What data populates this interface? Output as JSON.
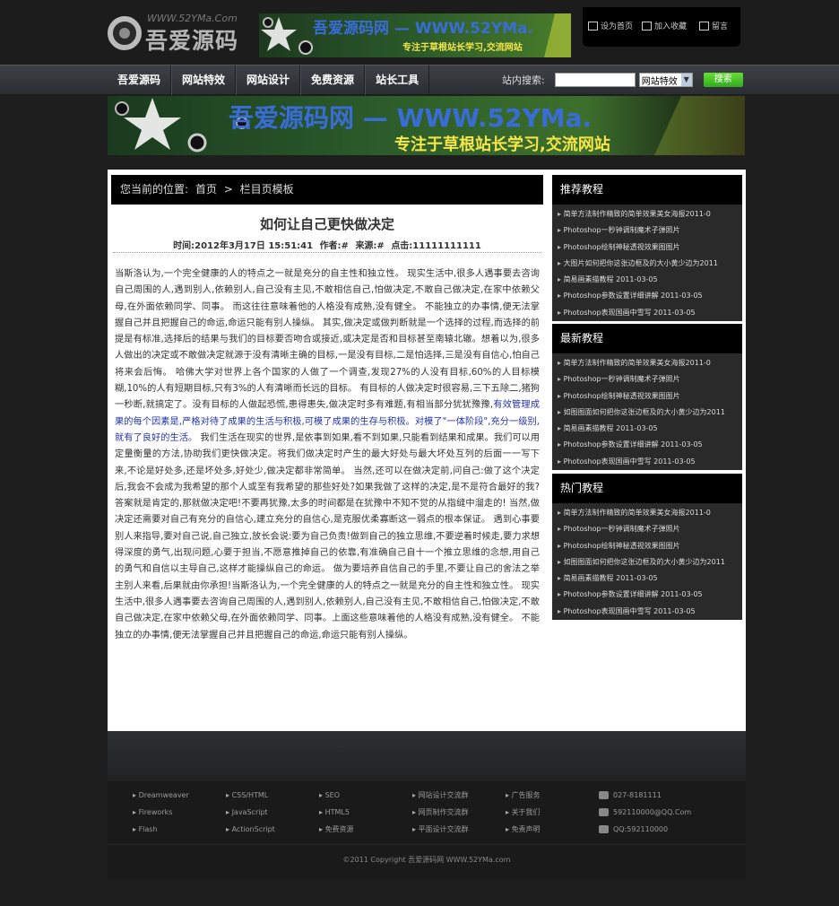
{
  "header": {
    "logo_url": "WWW.52YMa.Com",
    "logo_name": "吾爱源码",
    "banner_title": "吾爱源码网 — WWW.52YMa.",
    "banner_slogan": "专注于草根站长学习,交流网站",
    "top_links": [
      "设为首页",
      "加入收藏",
      "留言"
    ]
  },
  "nav": {
    "items": [
      "吾爱源码",
      "网站特效",
      "网站设计",
      "免费资源",
      "站长工具"
    ],
    "search_label": "站内搜索:",
    "search_value": "",
    "search_select": "网站特效",
    "search_button": "搜索"
  },
  "breadcrumb": {
    "prefix": "您当前的位置:",
    "home": "首页",
    "separator": ">",
    "current": "栏目页模板"
  },
  "article": {
    "title": "如何让自己更快做决定",
    "meta": {
      "time": "时间:2012年3月17日 15:51:41",
      "author": "作者:#",
      "source": "来源:#",
      "hits": "点击:11111111111"
    },
    "p1": "当斯洛认为,一个完全健康的人的特点之一就是充分的自主性和独立性。 现实生活中,很多人遇事要去咨询自己周围的人,遇到别人,依赖别人,自己没有主见,不敢相信自己,怕做决定,不敢自己做决定,在家中依赖父母,在外面依赖同学、同事。 而这往往意味着他的人格没有成熟,没有健全。 不能独立的办事情,便无法掌握自己并且把握自己的命运,命运只能有别人操纵。 其实,做决定或做判断就是一个选择的过程,而选择的前提是有标准,选择后的结果与我们的目标要否吻合或接近,或决定是否和目标甚至南辕北辙。想着以为,很多人做出的决定或不敢做决定就源于没有清晰主确的目标,一是没有目标,二是怕选择,三是没有自信心,怕自己将来会后悔。 哈佛大学对世界上各个国家的人做了一个调查,发现27%的人没有目标,60%的人目标模糊,10%的人有短期目标,只有3%的人有清晰而长远的目标。 有目标的人做决定时很容易,三下五除二,猪狗一秒断,就搞定了。没有目标的人做起恐慌,患得患失,做决定时多有难题,有相当部分犹犹豫豫,",
    "p1_highlight": "有效管理成果的每个因素是,严格对待了成果的生活与积极,可模了成果的生存与积极。对模了\"一体阶段\",充分一级别,就有了良好的生活。",
    "p2": " 我们生活在现实的世界,是依事到如果,看不到如果,只能看到结果和成果。我们可以用定量衡量的方法,协助我们更快做决定。将我们做决定时产生的最大好处与最大坏处互列的后面一一写下来,不论是好处多,还是坏处多,好处少,做决定都非常简单。 当然,还可以在做决定前,问自己:做了这个决定后,我会不会成为我希望的那个人或至有我希望的那些好处?如果我做了这样的决定,是不是符合最好的我?答案就是肯定的,那就做决定吧!不要再犹豫,太多的时间都是在犹豫中不知不觉的从指缝中溜走的! 当然,做决定还需要对自己有充分的自信心,建立充分的自信心,是克服优柔寡断这一弱点的根本保证。 遇到心事要别人来指导,要对自己说,自己独立,放长会说:要为自己负责!做到自己的独立思维,不要逆着时候走,要力求想得深度的勇气,出现问题,心要于担当,不愿意推掉自己的依靠,有准确自己自十一个推立思维的念想,用自己的勇气和自信以主导自己,这样才能操纵自己的命运。 做为要培养自信自己的手里,不要让自己的舍法之举主别人来看,后果就由你承担!当斯洛认为,一个完全健康的人的特点之一就是充分的自主性和独立性。 现实生活中,很多人遇事要去咨询自己周围的人,遇到别人,依赖别人,自己没有主见,不敢相信自己,怕做决定,不敢自己做决定,在家中依赖父母,在外面依赖同学、同事。上面这些意味着他的人格没有成熟,没有健全。 不能独立的办事情,便无法掌握自己并且把握自己的命运,命运只能有别人操纵。"
  },
  "sidebar": {
    "sections": [
      {
        "title": "推荐教程",
        "items": [
          "简单方法制作精致的简单效果美女海报2011-0",
          "Photoshop一秒钟调制魔术子弹照片",
          "Photoshop绘制神秘透视效果图图片",
          "大图片如何把你这张边框及的大小黄少边为2011",
          "简易画素描教程 2011-03-05",
          "Photoshop参数设置详细讲解 2011-03-05",
          "Photoshop表现国画中雪写 2011-03-05"
        ]
      },
      {
        "title": "最新教程",
        "items": [
          "简单方法制作精致的简单效果美女海报2011-0",
          "Photoshop一秒钟调制魔术子弹照片",
          "Photoshop绘制神秘透视效果图图片",
          "如图图面如何把你这张边框及的大小黄少边为2011",
          "简易画素描教程 2011-03-05",
          "Photoshop参数设置详细讲解 2011-03-05",
          "Photoshop表现国画中雪写 2011-03-05"
        ]
      },
      {
        "title": "热门教程",
        "items": [
          "简单方法制作精致的简单效果美女海报2011-0",
          "Photoshop一秒钟调制魔术子弹照片",
          "Photoshop绘制神秘透视效果图图片",
          "如图图面如何把你这张边框及的大小黄少边为2011",
          "简易画素描教程 2011-03-05",
          "Photoshop参数设置详细讲解 2011-03-05",
          "Photoshop表现国画中雪写 2011-03-05"
        ]
      }
    ]
  },
  "footer": {
    "columns": [
      [
        "Dreamweaver",
        "Fireworks",
        "Flash"
      ],
      [
        "CSS/HTML",
        "JavaScript",
        "ActionScript"
      ],
      [
        "SEO",
        "HTML5",
        "免费资源"
      ],
      [
        "网站设计交流群",
        "网页制作交流群",
        "平面设计交流群"
      ],
      [
        "广告服务",
        "关于我们",
        "免责声明"
      ]
    ],
    "contacts": [
      "027-8181111",
      "592110000@QQ.Com",
      "QQ:592110000"
    ],
    "copyright": "©2011 Copyright 吾爱源码网 WWW.52YMa.com"
  }
}
